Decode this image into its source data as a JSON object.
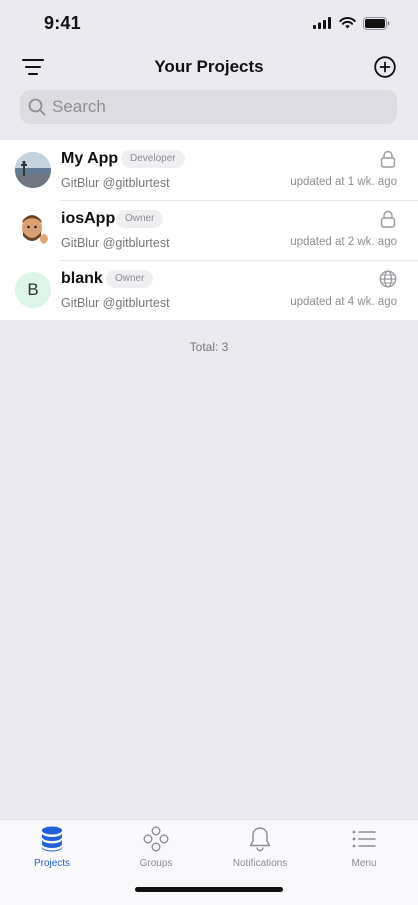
{
  "status_bar": {
    "time": "9:41"
  },
  "header": {
    "title": "Your Projects"
  },
  "search": {
    "placeholder": "Search"
  },
  "projects": [
    {
      "name": "My App",
      "role": "Developer",
      "owner": "GitBlur @gitblurtest",
      "updated": "updated at 1 wk. ago",
      "visibility": "lock-icon",
      "avatar": "photo"
    },
    {
      "name": "iosApp",
      "role": "Owner",
      "owner": "GitBlur @gitblurtest",
      "updated": "updated at 2 wk. ago",
      "visibility": "lock-icon",
      "avatar": "memoji"
    },
    {
      "name": "blank",
      "role": "Owner",
      "owner": "GitBlur @gitblurtest",
      "updated": "updated at 4 wk. ago",
      "visibility": "globe-icon",
      "avatar_letter": "B"
    }
  ],
  "total": "Total: 3",
  "tabs": [
    {
      "label": "Projects",
      "icon": "database-icon",
      "active": true
    },
    {
      "label": "Groups",
      "icon": "groups-icon",
      "active": false
    },
    {
      "label": "Notifications",
      "icon": "bell-icon",
      "active": false
    },
    {
      "label": "Menu",
      "icon": "list-icon",
      "active": false
    }
  ],
  "colors": {
    "accent": "#2260d9",
    "background": "#eaeaf0",
    "avatar_letter_bg": "#dcf5e6"
  }
}
